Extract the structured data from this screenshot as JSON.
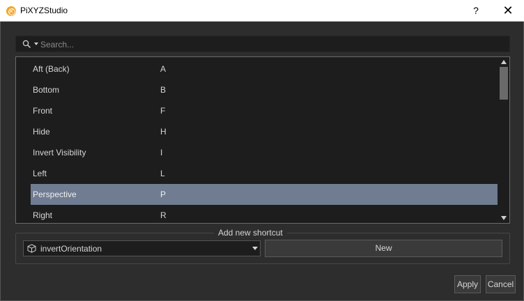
{
  "window": {
    "title": "PiXYZStudio",
    "help_label": "?",
    "close_label": "✕"
  },
  "search": {
    "placeholder": "Search..."
  },
  "shortcuts": [
    {
      "name": "Aft (Back)",
      "key": "A"
    },
    {
      "name": "Bottom",
      "key": "B"
    },
    {
      "name": "Front",
      "key": "F"
    },
    {
      "name": "Hide",
      "key": "H"
    },
    {
      "name": "Invert Visibility",
      "key": "I"
    },
    {
      "name": "Left",
      "key": "L"
    },
    {
      "name": "Perspective",
      "key": "P"
    },
    {
      "name": "Right",
      "key": "R"
    }
  ],
  "selected_shortcut": "Perspective",
  "add_shortcut": {
    "group_title": "Add new shortcut",
    "command_value": "invertOrientation",
    "new_label": "New"
  },
  "footer": {
    "apply_label": "Apply",
    "cancel_label": "Cancel"
  },
  "colors": {
    "background": "#2d2d2d",
    "list_background": "#1d1d1d",
    "selection": "#6f7c92",
    "app_icon": "#f5a623"
  }
}
